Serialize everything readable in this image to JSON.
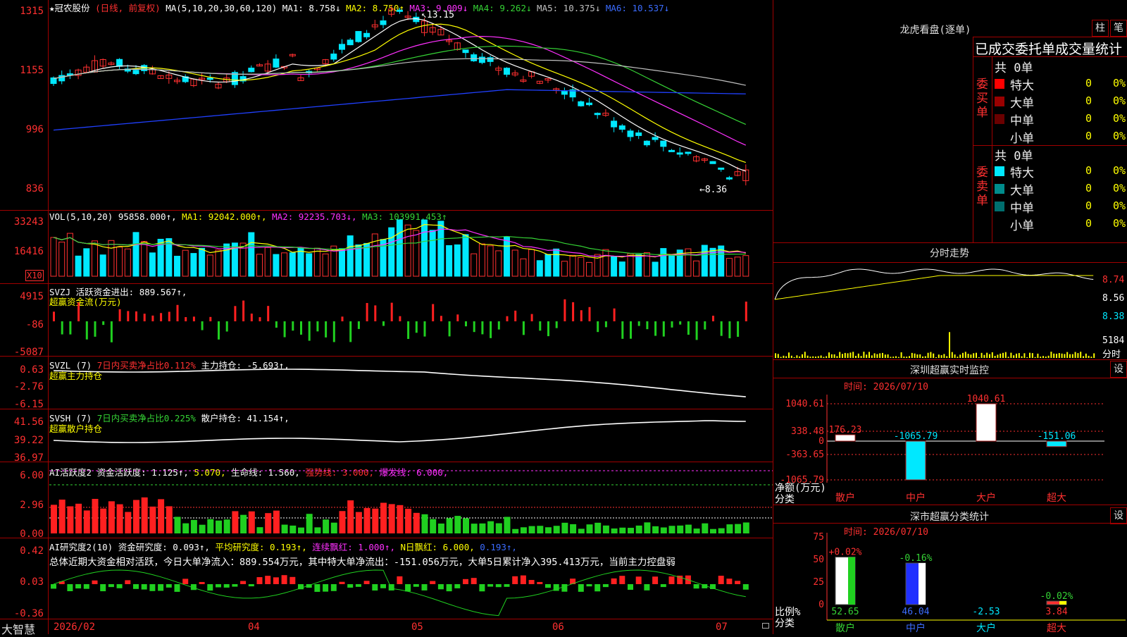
{
  "stock": {
    "name": "★冠农股份",
    "mode": "(日线, 前复权)",
    "ma_label": "MA(5,10,20,30,60,120)",
    "ma": [
      {
        "label": "MA1:",
        "value": "8.758↓",
        "color": "#ffffff"
      },
      {
        "label": "MA2:",
        "value": "8.750↑",
        "color": "#ffff00"
      },
      {
        "label": "MA3:",
        "value": "9.009↓",
        "color": "#ff30ff"
      },
      {
        "label": "MA4:",
        "value": "9.262↓",
        "color": "#35d335"
      },
      {
        "label": "MA5:",
        "value": "10.375↓",
        "color": "#c0c0c0"
      },
      {
        "label": "MA6:",
        "value": "10.537↓",
        "color": "#3b6cff"
      }
    ],
    "high_label": "13.15",
    "low_label": "8.36",
    "y_ticks": [
      "1315",
      "1155",
      "996",
      "836"
    ]
  },
  "volume": {
    "legend": "VOL(5,10,20)",
    "value": "95858.000↑,",
    "ma1": "MA1: 92042.000↑,",
    "ma2": "MA2: 92235.703↓,",
    "ma3": "MA3: 103991.453↑",
    "y_ticks": [
      "33243",
      "16416"
    ],
    "unit": "X10"
  },
  "svzj": {
    "legend": "SVZJ",
    "text": "活跃资金进出: 889.567↑,",
    "subtitle": "超赢资金流(万元)",
    "y_ticks": [
      "4915",
      "-86",
      "-5087"
    ]
  },
  "svzl": {
    "legend": "SVZL (7)",
    "ratio": "7日内买卖净占比0.112%",
    "text": "主力持仓: -5.693↑,",
    "subtitle": "超赢主力持仓",
    "y_ticks": [
      "0.63",
      "-2.76",
      "-6.15"
    ]
  },
  "svsh": {
    "legend": "SVSH (7)",
    "ratio": "7日内买卖净占比0.225%",
    "text": "散户持仓: 41.154↑,",
    "subtitle": "超赢散户持仓",
    "y_ticks": [
      "41.56",
      "39.22",
      "36.97"
    ]
  },
  "ai_active": {
    "legend": "AI活跃度2",
    "a": "资金活跃度: 1.125↑,",
    "b": "5.070,",
    "c": "生命线: 1.560,",
    "d": "强势线: 3.000,",
    "e": "爆发线: 6.000,",
    "y_ticks": [
      "6.00",
      "2.96",
      "0.00"
    ]
  },
  "ai_research": {
    "legend": "AI研究度2(10)",
    "a": "资金研究度: 0.093↑,",
    "b": "平均研究度: 0.193↑,",
    "c": "连续飘红: 1.000↑,",
    "d": "N日飘红: 6.000,",
    "e": "0.193↑,",
    "summary": "总体近期大资金相对活跃，今日大单净流入：889.554万元，其中特大单净流出：-151.056万元，大单5日累计净入395.413万元，当前主力控盘弱",
    "y_ticks": [
      "0.42",
      "0.03",
      "-0.36"
    ]
  },
  "bottom": {
    "brand": "大智慧",
    "dates": [
      "2026/02",
      "04",
      "05",
      "06",
      "07"
    ]
  },
  "longhu": {
    "title": "龙虎看盘(逐单)",
    "btn_zhu": "柱",
    "btn_bi": "笔",
    "tabs": "已成交委托单成交量统计",
    "buy_label": "委买单",
    "sell_label": "委卖单",
    "buy_total": "共 0单",
    "sell_total": "共 0单",
    "buy_rows": [
      {
        "name": "特大",
        "count": "0",
        "pct": "0%",
        "color": "#ff0000"
      },
      {
        "name": "大单",
        "count": "0",
        "pct": "0%",
        "color": "#9a0000"
      },
      {
        "name": "中单",
        "count": "0",
        "pct": "0%",
        "color": "#6a0000"
      },
      {
        "name": "小单",
        "count": "0",
        "pct": "0%",
        "color": ""
      }
    ],
    "sell_rows": [
      {
        "name": "特大",
        "count": "0",
        "pct": "0%",
        "color": "#00e8ff"
      },
      {
        "name": "大单",
        "count": "0",
        "pct": "0%",
        "color": "#008c8c"
      },
      {
        "name": "中单",
        "count": "0",
        "pct": "0%",
        "color": "#006e6e"
      },
      {
        "name": "小单",
        "count": "0",
        "pct": "0%",
        "color": ""
      }
    ]
  },
  "intraday": {
    "title": "分时走势",
    "y_ticks": [
      "8.74",
      "8.56",
      "8.38"
    ],
    "vol_tick": "5184",
    "vol_unit": "分时"
  },
  "monitor": {
    "title": "深圳超赢实时监控",
    "btn": "设",
    "time": "时间: 2026/07/10",
    "y_ticks": [
      "1040.61",
      "338.48",
      "0",
      "-363.65",
      "-1065.79"
    ],
    "y_unit": "净额(万元)",
    "x_unit": "分类",
    "categories": [
      "散户",
      "中户",
      "大户",
      "超大"
    ],
    "values": [
      "176.23",
      "-1065.79",
      "1040.61",
      "-151.06"
    ]
  },
  "classify": {
    "title": "深市超赢分类统计",
    "btn": "设",
    "time": "时间: 2026/07/10",
    "y_ticks": [
      "75",
      "50",
      "25",
      "0"
    ],
    "y_unit": "比例%",
    "x_unit": "分类",
    "categories": [
      "散户",
      "中户",
      "大户",
      "超大"
    ],
    "pct_top": [
      "+0.02%",
      "-0.16%",
      "",
      "-0.02%"
    ],
    "values": [
      "52.65",
      "46.04",
      "-2.53",
      "3.84"
    ]
  },
  "chart_data": [
    {
      "type": "bar",
      "title": "深圳超赢实时监控",
      "ylabel": "净额(万元)",
      "categories": [
        "散户",
        "中户",
        "大户",
        "超大"
      ],
      "values": [
        176.23,
        -1065.79,
        1040.61,
        -151.06
      ],
      "ylim": [
        -1065.79,
        1040.61
      ]
    },
    {
      "type": "bar",
      "title": "深市超赢分类统计",
      "ylabel": "比例%",
      "categories": [
        "散户",
        "中户",
        "大户",
        "超大"
      ],
      "values": [
        52.65,
        46.04,
        -2.53,
        3.84
      ],
      "ylim": [
        0,
        75
      ]
    }
  ]
}
